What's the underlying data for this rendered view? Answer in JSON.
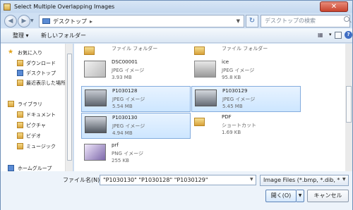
{
  "window": {
    "title": "Select Multiple Overlapping Images",
    "close_label": "✕"
  },
  "address": {
    "location": "デスクトップ",
    "search_placeholder": "デスクトップの検索"
  },
  "toolbar": {
    "organize_label": "整理 ▾",
    "new_folder_label": "新しいフォルダー"
  },
  "sidebar": {
    "favorites": "お気に入り",
    "items": [
      "ダウンロード",
      "デスクトップ",
      "最近表示した場所"
    ],
    "libraries": "ライブラリ",
    "library_items": [
      "ドキュメント",
      "ピクチャ",
      "ビデオ",
      "ミュージック"
    ],
    "homegroup": "ホームグループ"
  },
  "files": [
    {
      "name": "",
      "type": "ファイル フォルダー",
      "size": ""
    },
    {
      "name": "",
      "type": "ファイル フォルダー",
      "size": ""
    },
    {
      "name": "DSC00001",
      "type": "JPEG イメージ",
      "size": "3.93 MB"
    },
    {
      "name": "ice",
      "type": "JPEG イメージ",
      "size": "95.8 KB"
    },
    {
      "name": "P1030128",
      "type": "JPEG イメージ",
      "size": "5.54 MB"
    },
    {
      "name": "P1030129",
      "type": "JPEG イメージ",
      "size": "5.45 MB"
    },
    {
      "name": "P1030130",
      "type": "JPEG イメージ",
      "size": "4.94 MB"
    },
    {
      "name": "PDF",
      "type": "ショートカット",
      "size": "1.69 KB"
    },
    {
      "name": "prf",
      "type": "PNG イメージ",
      "size": "255 KB"
    }
  ],
  "bottom": {
    "filename_label": "ファイル名(N):",
    "filename_value": "\"P1030130\" \"P1030128\" \"P1030129\"",
    "filter_value": "Image Files (*.bmp, *.dib, *",
    "open_label": "開く(O)",
    "cancel_label": "キャンセル"
  }
}
